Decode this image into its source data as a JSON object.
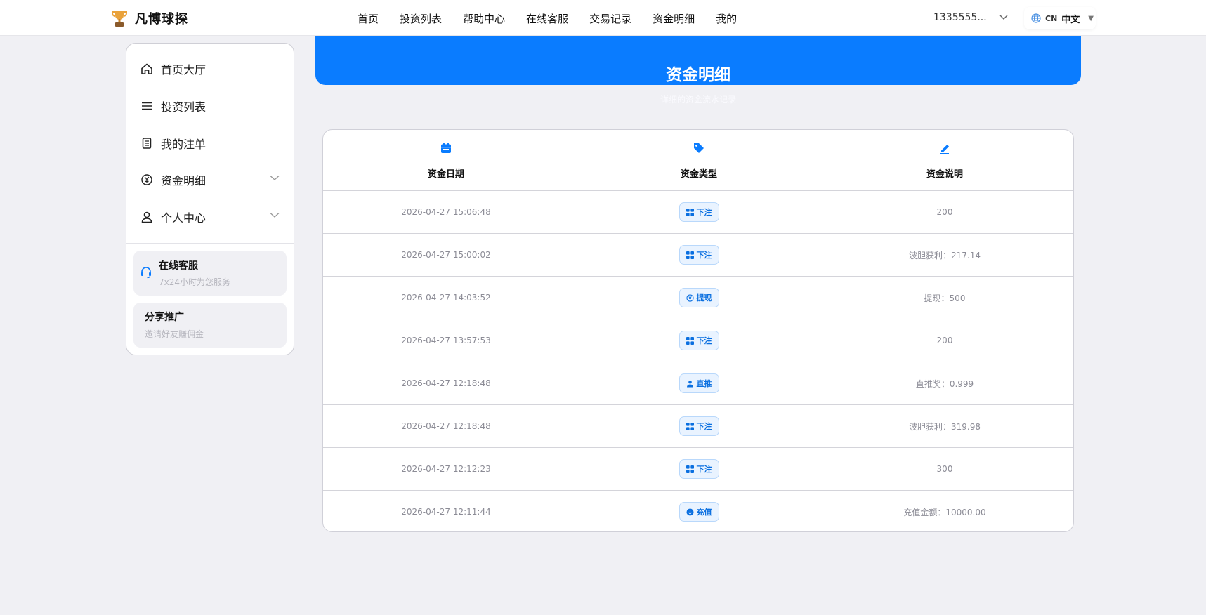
{
  "header": {
    "brand": "凡博球探",
    "nav": [
      "首页",
      "投资列表",
      "帮助中心",
      "在线客服",
      "交易记录",
      "资金明细",
      "我的"
    ],
    "user": "1335555...",
    "lang_code": "CN",
    "lang_label": "中文"
  },
  "sidebar": {
    "items": [
      {
        "label": "首页大厅",
        "icon": "home-icon"
      },
      {
        "label": "投资列表",
        "icon": "menu-icon"
      },
      {
        "label": "我的注单",
        "icon": "document-icon"
      },
      {
        "label": "资金明细",
        "icon": "yuan-icon"
      },
      {
        "label": "个人中心",
        "icon": "user-icon"
      }
    ],
    "support": {
      "title": "在线客服",
      "subtitle": "7x24小时为您服务"
    },
    "promo": {
      "title": "分享推广",
      "subtitle": "邀请好友赚佣金"
    }
  },
  "main": {
    "title": "资金明细",
    "subtitle": "详细的资金流水记录",
    "columns": [
      "资金日期",
      "资金类型",
      "资金说明"
    ],
    "rows": [
      {
        "date": "2026-04-27 15:06:48",
        "type": "下注",
        "type_icon": "grid-icon",
        "desc": "200"
      },
      {
        "date": "2026-04-27 15:00:02",
        "type": "下注",
        "type_icon": "grid-icon",
        "desc": "波胆获利：217.14"
      },
      {
        "date": "2026-04-27 14:03:52",
        "type": "提现",
        "type_icon": "withdraw-icon",
        "desc": "提现：500"
      },
      {
        "date": "2026-04-27 13:57:53",
        "type": "下注",
        "type_icon": "grid-icon",
        "desc": "200"
      },
      {
        "date": "2026-04-27 12:18:48",
        "type": "直推",
        "type_icon": "user-icon",
        "desc": "直推奖：0.999"
      },
      {
        "date": "2026-04-27 12:18:48",
        "type": "下注",
        "type_icon": "grid-icon",
        "desc": "波胆获利：319.98"
      },
      {
        "date": "2026-04-27 12:12:23",
        "type": "下注",
        "type_icon": "grid-icon",
        "desc": "300"
      },
      {
        "date": "2026-04-27 12:11:44",
        "type": "充值",
        "type_icon": "deposit-icon",
        "desc": "充值金额：10000.00"
      }
    ]
  },
  "colors": {
    "accent": "#0a7cff",
    "background": "#f0f0f4"
  }
}
